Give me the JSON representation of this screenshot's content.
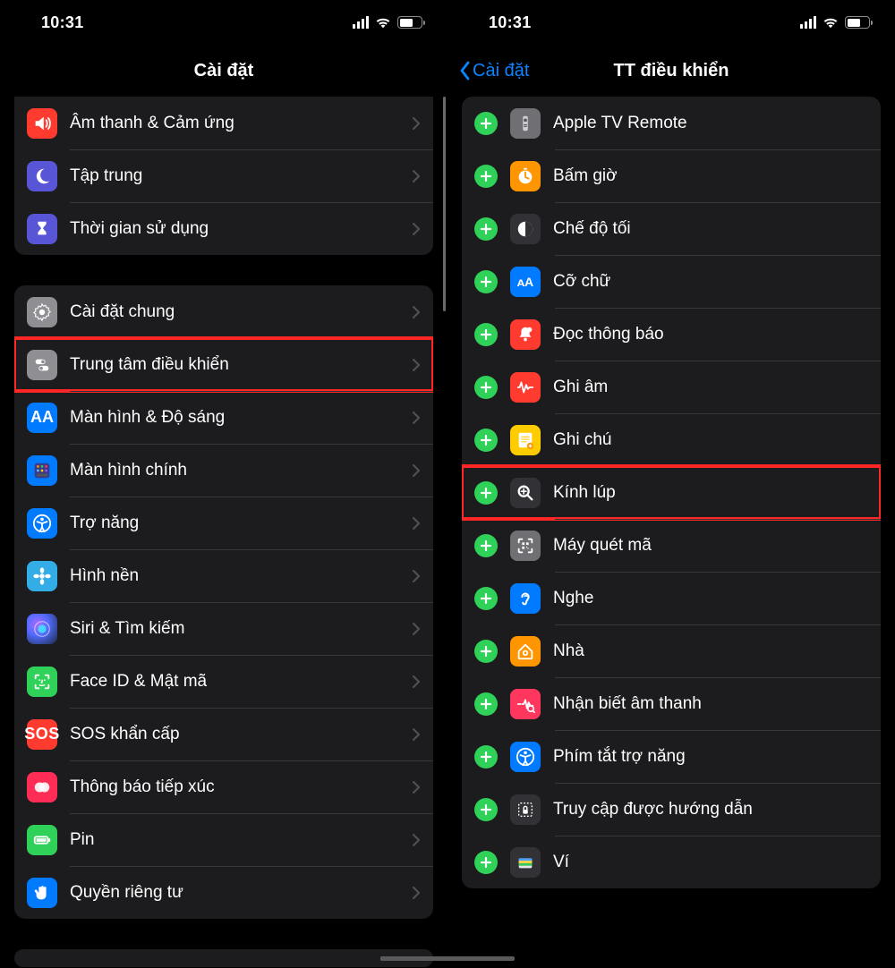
{
  "status": {
    "time": "10:31"
  },
  "left": {
    "title": "Cài đặt",
    "group1": [
      {
        "label": "Âm thanh & Cảm ứng",
        "icon": "sound",
        "bg": "bg-red"
      },
      {
        "label": "Tập trung",
        "icon": "moon",
        "bg": "bg-indigo"
      },
      {
        "label": "Thời gian sử dụng",
        "icon": "hourglass",
        "bg": "bg-indigo"
      }
    ],
    "group2": [
      {
        "label": "Cài đặt chung",
        "icon": "gear",
        "bg": "bg-gray"
      },
      {
        "label": "Trung tâm điều khiển",
        "icon": "toggles",
        "bg": "bg-gray",
        "highlight": true
      },
      {
        "label": "Màn hình & Độ sáng",
        "icon": "AA",
        "bg": "bg-blue",
        "txt": true
      },
      {
        "label": "Màn hình chính",
        "icon": "grid",
        "bg": "bg-blue"
      },
      {
        "label": "Trợ năng",
        "icon": "access",
        "bg": "bg-blue"
      },
      {
        "label": "Hình nền",
        "icon": "flower",
        "bg": "bg-teal"
      },
      {
        "label": "Siri & Tìm kiếm",
        "icon": "siri",
        "bg": "bg-siri"
      },
      {
        "label": "Face ID & Mật mã",
        "icon": "faceid",
        "bg": "bg-green"
      },
      {
        "label": "SOS khẩn cấp",
        "icon": "SOS",
        "bg": "bg-red",
        "txt": true,
        "txtClass": "txt-s"
      },
      {
        "label": "Thông báo tiếp xúc",
        "icon": "exposure",
        "bg": "bg-dots"
      },
      {
        "label": "Pin",
        "icon": "battery",
        "bg": "bg-green"
      },
      {
        "label": "Quyền riêng tư",
        "icon": "hand",
        "bg": "bg-blue"
      }
    ]
  },
  "right": {
    "back": "Cài đặt",
    "title": "TT điều khiển",
    "items": [
      {
        "label": "Apple TV Remote",
        "icon": "remote",
        "bg": "bg-mgray"
      },
      {
        "label": "Bấm giờ",
        "icon": "stopwatch",
        "bg": "bg-orange"
      },
      {
        "label": "Chế độ tối",
        "icon": "darkmode",
        "bg": "bg-darkgray"
      },
      {
        "label": "Cỡ chữ",
        "icon": "ᴀA",
        "bg": "bg-blue",
        "txt": true
      },
      {
        "label": "Đọc thông báo",
        "icon": "bell",
        "bg": "bg-red"
      },
      {
        "label": "Ghi âm",
        "icon": "wave",
        "bg": "bg-red"
      },
      {
        "label": "Ghi chú",
        "icon": "note",
        "bg": "bg-yellow"
      },
      {
        "label": "Kính lúp",
        "icon": "magnify",
        "bg": "bg-darkgray",
        "highlight": true
      },
      {
        "label": "Máy quét mã",
        "icon": "qr",
        "bg": "bg-mgray"
      },
      {
        "label": "Nghe",
        "icon": "ear",
        "bg": "bg-blue"
      },
      {
        "label": "Nhà",
        "icon": "home",
        "bg": "bg-orange"
      },
      {
        "label": "Nhận biết âm thanh",
        "icon": "soundrec",
        "bg": "bg-pink"
      },
      {
        "label": "Phím tắt trợ năng",
        "icon": "access",
        "bg": "bg-blue"
      },
      {
        "label": "Truy cập được hướng dẫn",
        "icon": "lock",
        "bg": "bg-darkgray"
      },
      {
        "label": "Ví",
        "icon": "wallet",
        "bg": "bg-darkgray"
      }
    ]
  }
}
